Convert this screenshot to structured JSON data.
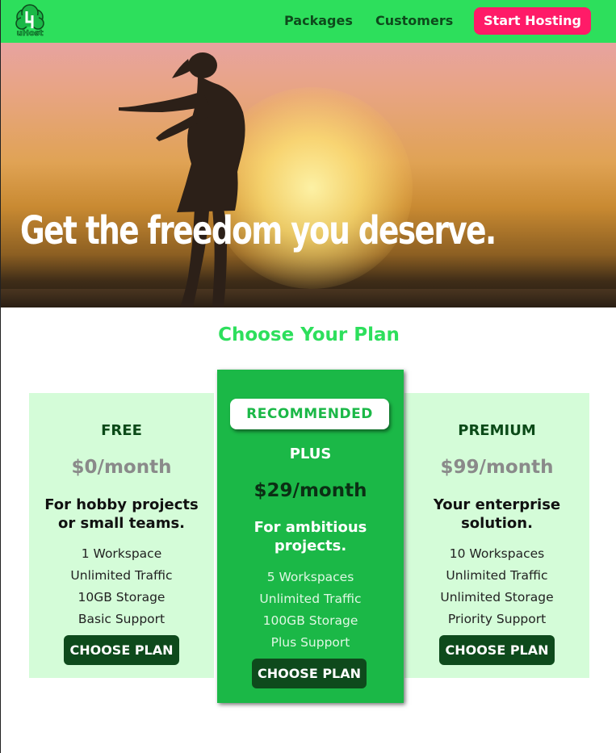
{
  "nav": {
    "logo_text": "uHost",
    "links": [
      "Packages",
      "Customers"
    ],
    "cta": "Start Hosting"
  },
  "hero": {
    "title": "Get the freedom you deserve."
  },
  "plans_section": {
    "title": "Choose Your Plan",
    "plans": [
      {
        "name": "FREE",
        "price": "$0/month",
        "description": [
          "For hobby projects",
          "or small teams."
        ],
        "features": [
          "1 Workspace",
          "Unlimited Traffic",
          "10GB Storage",
          "Basic Support"
        ],
        "button": "CHOOSE PLAN"
      },
      {
        "badge": "RECOMMENDED",
        "name": "PLUS",
        "price": "$29/month",
        "description": [
          "For ambitious",
          "projects."
        ],
        "features": [
          "5 Workspaces",
          "Unlimited Traffic",
          "100GB Storage",
          "Plus Support"
        ],
        "button": "CHOOSE PLAN"
      },
      {
        "name": "PREMIUM",
        "price": "$99/month",
        "description": [
          "Your enterprise",
          "solution."
        ],
        "features": [
          "10 Workspaces",
          "Unlimited Traffic",
          "Unlimited Storage",
          "Priority Support"
        ],
        "button": "CHOOSE PLAN"
      }
    ]
  },
  "colors": {
    "brand_green": "#2ddf5c",
    "recommended_green": "#1bb847",
    "plan_bg": "#d4fcd8",
    "dark_green": "#0e4a1c",
    "cta_pink": "#ff1b68"
  }
}
